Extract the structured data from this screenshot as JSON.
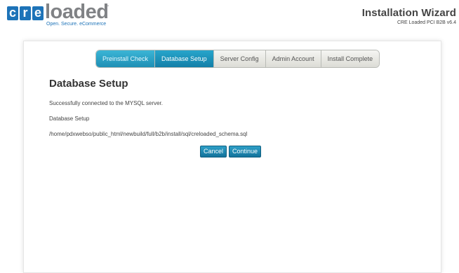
{
  "header": {
    "logo": {
      "letters": [
        "c",
        "r",
        "e"
      ],
      "word": "loaded",
      "tm": "™",
      "tagline": "Open. Secure. eCommerce"
    },
    "title": "Installation Wizard",
    "version": "CRE Loaded PCI B2B v6.4"
  },
  "steps": [
    {
      "label": "Preinstall Check",
      "state": "done"
    },
    {
      "label": "Database Setup",
      "state": "active"
    },
    {
      "label": "Server Config",
      "state": "pending"
    },
    {
      "label": "Admin Account",
      "state": "pending"
    },
    {
      "label": "Install Complete",
      "state": "pending"
    }
  ],
  "main": {
    "heading": "Database Setup",
    "status": "Successfully connected to the MYSQL server.",
    "subtitle": "Database Setup",
    "path": "/home/pdxwebso/public_html/newbuild/full/b2b/install/sql/creloaded_schema.sql"
  },
  "buttons": {
    "cancel": "Cancel",
    "continue": "Continue"
  },
  "colors": {
    "brand_blue": "#1d73b8",
    "step_active": "#1e8fb5",
    "button": "#13729b"
  }
}
